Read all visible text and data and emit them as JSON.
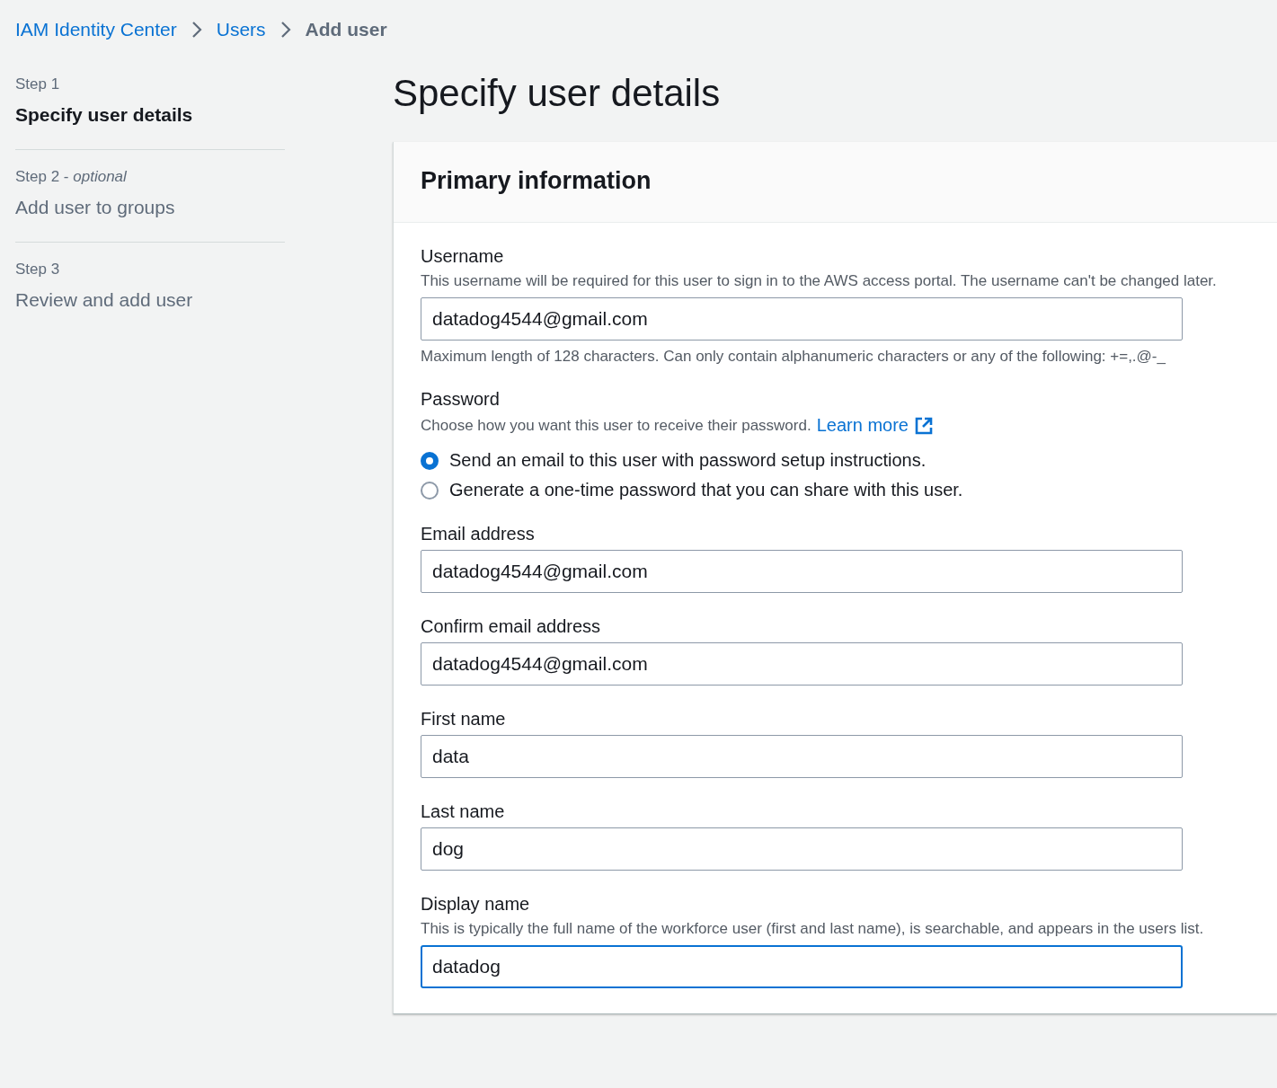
{
  "breadcrumbs": [
    {
      "label": "IAM Identity Center",
      "kind": "link"
    },
    {
      "label": "Users",
      "kind": "link"
    },
    {
      "label": "Add user",
      "kind": "current"
    }
  ],
  "steps": [
    {
      "step": "Step 1",
      "title": "Specify user details",
      "selected": true
    },
    {
      "step": "Step 2 - *optional*",
      "title": "Add user to groups",
      "selected": false
    },
    {
      "step": "Step 3",
      "title": "Review and add user",
      "selected": false
    }
  ],
  "page_title": "Specify user details",
  "panel": {
    "title": "Primary information",
    "fields": [
      {
        "kind": "text",
        "label": "Username",
        "description": "This username will be required for this user to sign in to the AWS access portal. The username can't be changed later.",
        "value": "datadog4544@gmail.com",
        "hint": "Maximum length of 128 characters. Can only contain alphanumeric characters or any of the following: +=,.@-_",
        "focused": false
      },
      {
        "kind": "radio",
        "label": "Password",
        "description": "Choose how you want this user to receive their password.",
        "link": "Learn more",
        "options": [
          {
            "label": "Send an email to this user with password setup instructions.",
            "selected": true
          },
          {
            "label": "Generate a one-time password that you can share with this user.",
            "selected": false
          }
        ]
      },
      {
        "kind": "text",
        "label": "Email address",
        "value": "datadog4544@gmail.com",
        "focused": false
      },
      {
        "kind": "text",
        "label": "Confirm email address",
        "value": "datadog4544@gmail.com",
        "focused": false
      },
      {
        "kind": "text",
        "label": "First name",
        "value": "data",
        "focused": false
      },
      {
        "kind": "text",
        "label": "Last name",
        "value": "dog",
        "focused": false
      },
      {
        "kind": "text",
        "label": "Display name",
        "description": "This is typically the full name of the workforce user (first and last name), is searchable, and appears in the users list.",
        "value": "datadog",
        "focused": true
      }
    ]
  }
}
